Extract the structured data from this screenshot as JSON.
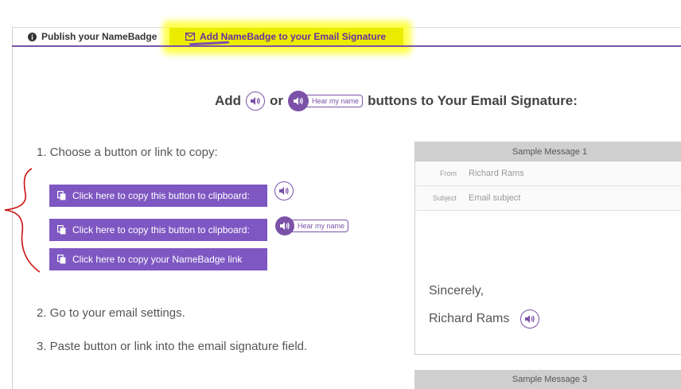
{
  "tabs": [
    {
      "label": "Publish your NameBadge",
      "icon": "info-circle-icon"
    },
    {
      "label": "Add NameBadge to your Email Signature",
      "icon": "envelope-icon"
    }
  ],
  "headline": {
    "part1": "Add",
    "part2": "or",
    "part3": "buttons to Your Email Signature:",
    "hear_label": "Hear my name"
  },
  "steps": {
    "step1": "1. Choose a button or link to copy:",
    "step2": "2. Go to your email settings.",
    "step3": "3. Paste button or link into the email signature field."
  },
  "buttons": {
    "copy_button_1": "Click here to copy this button to clipboard:",
    "copy_button_2": "Click here to copy this button to clipboard:",
    "copy_link": "Click here to copy your NameBadge link",
    "hear_label": "Hear my name"
  },
  "sample": {
    "title": "Sample Message 1",
    "from_label": "From",
    "from_value": "Richard Rams",
    "subject_label": "Subject",
    "subject_value": "Email subject",
    "closing": "Sincerely,",
    "name": "Richard Rams",
    "next_title": "Sample Message 3"
  },
  "colors": {
    "brand_purple": "#7b52a8",
    "button_purple": "#7e57c2",
    "highlight_yellow": "#ecec00",
    "annotation_red": "#cc1111"
  }
}
